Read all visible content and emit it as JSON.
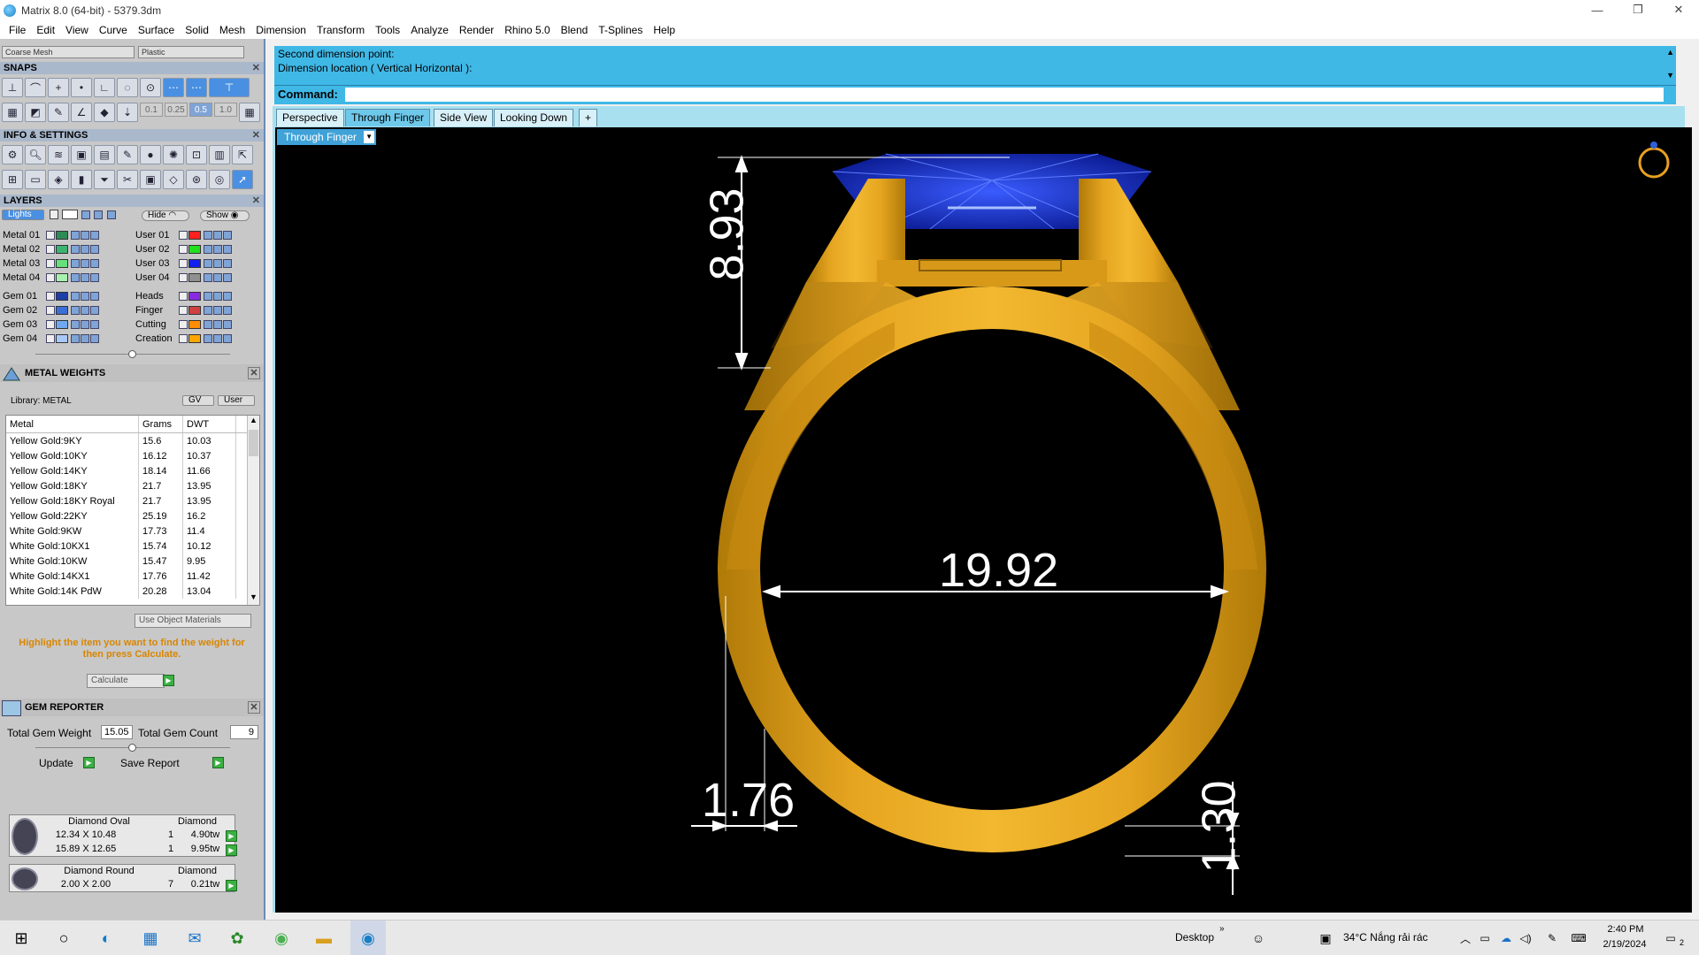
{
  "window": {
    "title": "Matrix 8.0 (64-bit) - 5379.3dm",
    "minimize": "—",
    "restore": "❐",
    "close": "✕"
  },
  "menu": [
    "File",
    "Edit",
    "View",
    "Curve",
    "Surface",
    "Solid",
    "Mesh",
    "Dimension",
    "Transform",
    "Tools",
    "Analyze",
    "Render",
    "Rhino 5.0",
    "Blend",
    "T-Splines",
    "Help"
  ],
  "left": {
    "mesh_combo": "Coarse Mesh",
    "material_combo": "Plastic",
    "snaps_header": "SNAPS",
    "snap_values": [
      "0.1",
      "0.25",
      "0.5",
      "1.0"
    ],
    "info_header": "INFO & SETTINGS",
    "layers_header": "LAYERS",
    "lights_label": "Lights",
    "hide_label": "Hide",
    "show_label": "Show",
    "layers_left": [
      {
        "name": "Metal 01",
        "color": "#2e8b57"
      },
      {
        "name": "Metal 02",
        "color": "#3cb371"
      },
      {
        "name": "Metal 03",
        "color": "#66e07a"
      },
      {
        "name": "Metal 04",
        "color": "#a8f0b0"
      },
      {
        "name": "Gem 01",
        "color": "#1e3fa8"
      },
      {
        "name": "Gem 02",
        "color": "#3a6fd8"
      },
      {
        "name": "Gem 03",
        "color": "#6fa8f0"
      },
      {
        "name": "Gem 04",
        "color": "#a8c8f8"
      }
    ],
    "layers_right": [
      {
        "name": "User 01",
        "color": "#ff2020"
      },
      {
        "name": "User 02",
        "color": "#20e020"
      },
      {
        "name": "User 03",
        "color": "#1020f0"
      },
      {
        "name": "User 04",
        "color": "#909090"
      },
      {
        "name": "Heads",
        "color": "#8a2be2"
      },
      {
        "name": "Finger",
        "color": "#d04040"
      },
      {
        "name": "Cutting",
        "color": "#ff8c00"
      },
      {
        "name": "Creation",
        "color": "#ffa500"
      }
    ],
    "metal_weights": {
      "header": "METAL WEIGHTS",
      "library": "Library: METAL",
      "gv_label": "GV",
      "user_label": "User",
      "columns": [
        "Metal",
        "Grams",
        "DWT"
      ],
      "rows": [
        [
          "Yellow Gold:9KY",
          "15.6",
          "10.03"
        ],
        [
          "Yellow Gold:10KY",
          "16.12",
          "10.37"
        ],
        [
          "Yellow Gold:14KY",
          "18.14",
          "11.66"
        ],
        [
          "Yellow Gold:18KY",
          "21.7",
          "13.95"
        ],
        [
          "Yellow Gold:18KY Royal",
          "21.7",
          "13.95"
        ],
        [
          "Yellow Gold:22KY",
          "25.19",
          "16.2"
        ],
        [
          "White Gold:9KW",
          "17.73",
          "11.4"
        ],
        [
          "White Gold:10KX1",
          "15.74",
          "10.12"
        ],
        [
          "White Gold:10KW",
          "15.47",
          "9.95"
        ],
        [
          "White Gold:14KX1",
          "17.76",
          "11.42"
        ],
        [
          "White Gold:14K PdW",
          "20.28",
          "13.04"
        ]
      ],
      "use_object_materials": "Use Object Materials",
      "hint": "Highlight the item you want to find the weight for then press Calculate.",
      "calculate": "Calculate"
    },
    "gem_reporter": {
      "header": "GEM REPORTER",
      "total_weight_label": "Total Gem Weight",
      "total_weight": "15.05",
      "total_count_label": "Total Gem Count",
      "total_count": "9",
      "update": "Update",
      "save_report": "Save Report",
      "groups": [
        {
          "shape": "Diamond Oval",
          "material": "Diamond",
          "rows": [
            [
              "12.34 X 10.48",
              "1",
              "4.90tw"
            ],
            [
              "15.89 X 12.65",
              "1",
              "9.95tw"
            ]
          ]
        },
        {
          "shape": "Diamond Round",
          "material": "Diamond",
          "rows": [
            [
              "2.00 X 2.00",
              "7",
              "0.21tw"
            ]
          ]
        }
      ]
    }
  },
  "command": {
    "line1": "Second dimension point:",
    "line2": "Dimension location ( Vertical  Horizontal ):",
    "prompt": "Command:"
  },
  "tabs": [
    "Perspective",
    "Through Finger",
    "Side View",
    "Looking Down",
    "+"
  ],
  "viewport": {
    "label": "Through Finger",
    "dims": {
      "top_height": "8.93",
      "inner_width": "19.92",
      "shank_width": "1.76",
      "shank_thickness": "1.30"
    }
  },
  "taskbar": {
    "desktop": "Desktop",
    "weather": "34°C  Nắng rải rác",
    "time": "2:40 PM",
    "date": "2/19/2024",
    "notif": "2"
  }
}
